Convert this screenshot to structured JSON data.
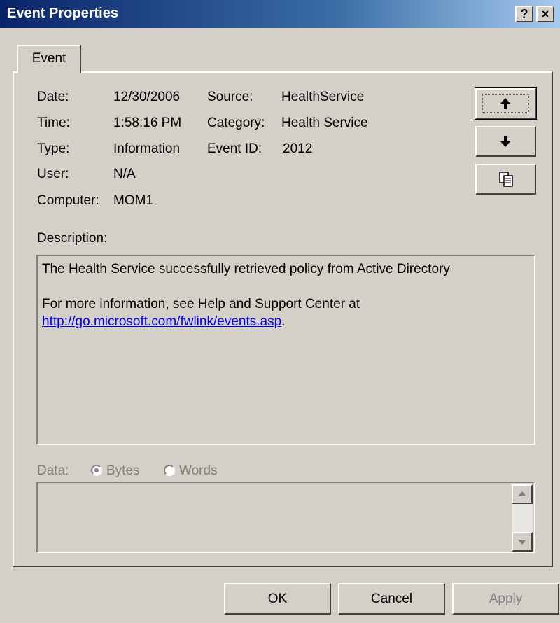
{
  "window": {
    "title": "Event Properties"
  },
  "titlebar": {
    "help_label": "?",
    "close_label": "×"
  },
  "tabs": [
    {
      "label": "Event"
    }
  ],
  "fields": {
    "date_label": "Date:",
    "date_value": "12/30/2006",
    "time_label": "Time:",
    "time_value": "1:58:16 PM",
    "type_label": "Type:",
    "type_value": "Information",
    "user_label": "User:",
    "user_value": "N/A",
    "computer_label": "Computer:",
    "computer_value": "MOM1",
    "source_label": "Source:",
    "source_value": "HealthService",
    "category_label": "Category:",
    "category_value": "Health Service",
    "eventid_label": "Event ID:",
    "eventid_value": "2012"
  },
  "side_buttons": {
    "up_icon": "arrow-up-icon",
    "down_icon": "arrow-down-icon",
    "copy_icon": "copy-icon"
  },
  "description": {
    "label": "Description:",
    "line1": "The Health Service successfully retrieved policy from Active Directory",
    "line2": "For more information, see Help and Support Center at",
    "link": "http://go.microsoft.com/fwlink/events.asp",
    "link_suffix": "."
  },
  "data_section": {
    "label": "Data:",
    "bytes_label": "Bytes",
    "words_label": "Words",
    "selected": "Bytes"
  },
  "buttons": {
    "ok": "OK",
    "cancel": "Cancel",
    "apply": "Apply"
  },
  "colors": {
    "title_gradient_start": "#0a246a",
    "title_gradient_end": "#a6caf0",
    "face": "#d4d0c8",
    "link": "#0000ee"
  }
}
